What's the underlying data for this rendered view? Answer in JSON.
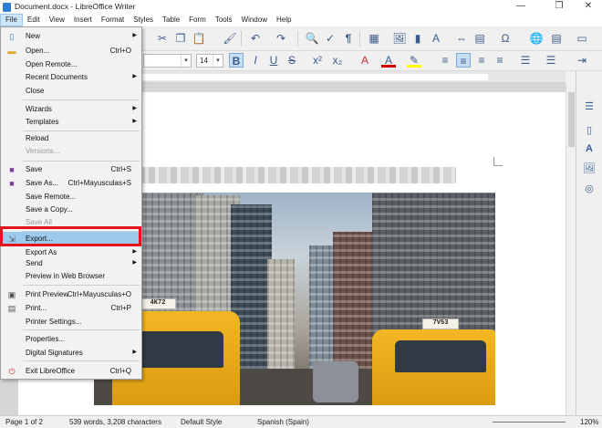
{
  "window": {
    "title": "Document.docx - LibreOffice Writer",
    "minimize": "—",
    "maximize": "❐",
    "close": "✕"
  },
  "menubar": [
    "File",
    "Edit",
    "View",
    "Insert",
    "Format",
    "Styles",
    "Table",
    "Form",
    "Tools",
    "Window",
    "Help"
  ],
  "formatting": {
    "font_size": "14"
  },
  "file_menu": [
    {
      "label": "New",
      "shortcut": "",
      "submenu": true,
      "icon": "new-doc-icon"
    },
    {
      "label": "Open...",
      "shortcut": "Ctrl+O",
      "icon": "folder-icon"
    },
    {
      "label": "Open Remote...",
      "shortcut": ""
    },
    {
      "label": "Recent Documents",
      "shortcut": "",
      "submenu": true
    },
    {
      "label": "Close",
      "shortcut": ""
    },
    {
      "label": "Wizards",
      "shortcut": "",
      "submenu": true
    },
    {
      "label": "Templates",
      "shortcut": "",
      "submenu": true
    },
    {
      "label": "Reload",
      "shortcut": ""
    },
    {
      "label": "Versions...",
      "shortcut": "",
      "disabled": true
    },
    {
      "label": "Save",
      "shortcut": "Ctrl+S",
      "icon": "save-icon"
    },
    {
      "label": "Save As...",
      "shortcut": "Ctrl+Mayusculas+S",
      "icon": "save-as-icon"
    },
    {
      "label": "Save Remote...",
      "shortcut": ""
    },
    {
      "label": "Save a Copy...",
      "shortcut": ""
    },
    {
      "label": "Save All",
      "shortcut": "",
      "disabled": true
    },
    {
      "label": "Export...",
      "shortcut": "",
      "highlighted": true,
      "icon": "export-icon"
    },
    {
      "label": "Export As",
      "shortcut": "",
      "submenu": true
    },
    {
      "label": "Send",
      "shortcut": "",
      "submenu": true
    },
    {
      "label": "Preview in Web Browser",
      "shortcut": ""
    },
    {
      "label": "Print Preview",
      "shortcut": "Ctrl+Mayusculas+O",
      "icon": "print-preview-icon"
    },
    {
      "label": "Print...",
      "shortcut": "Ctrl+P",
      "icon": "printer-icon"
    },
    {
      "label": "Printer Settings...",
      "shortcut": ""
    },
    {
      "label": "Properties...",
      "shortcut": ""
    },
    {
      "label": "Digital Signatures",
      "shortcut": "",
      "submenu": true
    },
    {
      "label": "Exit LibreOffice",
      "shortcut": "Ctrl+Q",
      "icon": "power-icon"
    }
  ],
  "photo": {
    "taxi_left_sign": "4K72",
    "taxi_right_sign": "7V53"
  },
  "statusbar": {
    "page": "Page 1 of 2",
    "words": "539 words, 3,208 characters",
    "style": "Default Style",
    "language": "Spanish (Spain)",
    "zoom": "120%"
  },
  "colors": {
    "highlight": "#9dc9ef",
    "annotation_box": "#e5141d",
    "menu_active": "#cce4f7"
  }
}
